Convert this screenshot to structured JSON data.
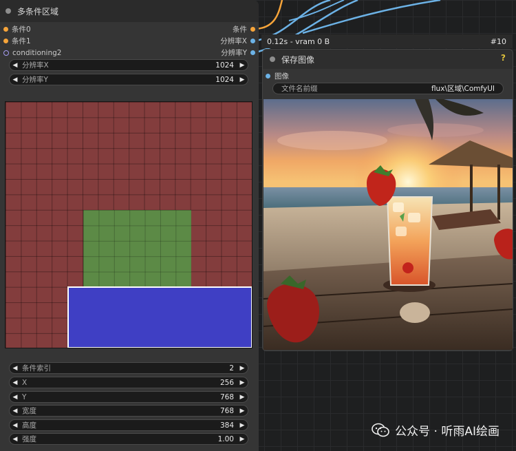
{
  "left_node": {
    "title": "多条件区域",
    "inputs": [
      {
        "label": "条件0",
        "color": "#f6a43a"
      },
      {
        "label": "条件1",
        "color": "#f6a43a"
      },
      {
        "label": "conditioning2",
        "color": "#a59cf2"
      }
    ],
    "outputs": [
      {
        "label": "条件",
        "color": "#f6a43a"
      },
      {
        "label": "分辨率X",
        "color": "#6cb2e6"
      },
      {
        "label": "分辨率Y",
        "color": "#6cb2e6"
      }
    ],
    "top_widgets": [
      {
        "label": "分辨率X",
        "value": "1024"
      },
      {
        "label": "分辨率Y",
        "value": "1024"
      }
    ],
    "canvas": {
      "background_color": "#833d3d",
      "regions": [
        {
          "color": "#5c8a46"
        },
        {
          "color": "#3f3fc4"
        }
      ]
    },
    "bottom_widgets": [
      {
        "label": "条件索引",
        "value": "2"
      },
      {
        "label": "X",
        "value": "256"
      },
      {
        "label": "Y",
        "value": "768"
      },
      {
        "label": "宽度",
        "value": "768"
      },
      {
        "label": "高度",
        "value": "384"
      },
      {
        "label": "强度",
        "value": "1.00"
      }
    ]
  },
  "status": {
    "timing": "0.12s - vram 0 B",
    "node_id": "#10"
  },
  "right_node": {
    "title": "保存图像",
    "help": "?",
    "input_label": "图像",
    "prefix": {
      "label": "文件名前缀",
      "value": "flux\\区域\\ComfyUI"
    },
    "image_icon": "beach-cocktail-image"
  },
  "watermark": {
    "text": "公众号 · 听雨AI绘画",
    "icon": "wechat-icon"
  },
  "icons": {
    "left_arrow": "◀",
    "right_arrow": "▶"
  },
  "colors": {
    "wire_orange": "#f6a43a",
    "wire_blue": "#6cb2e6",
    "help": "#e0c23c"
  }
}
